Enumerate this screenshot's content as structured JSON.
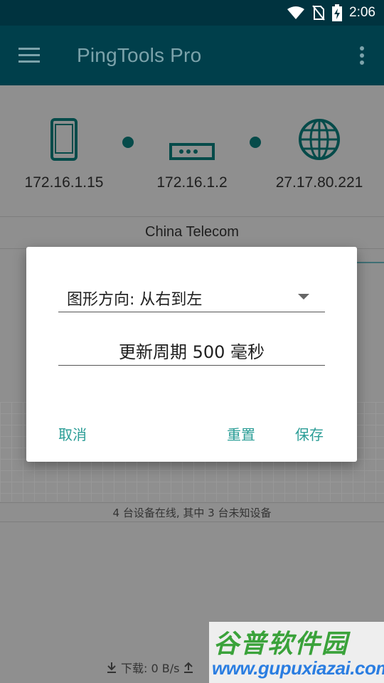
{
  "status_bar": {
    "time": "2:06"
  },
  "app_bar": {
    "title": "PingTools Pro"
  },
  "route": {
    "nodes": [
      {
        "ip": "172.16.1.15",
        "icon": "phone-icon"
      },
      {
        "ip": "172.16.1.2",
        "icon": "router-icon"
      },
      {
        "ip": "27.17.80.221",
        "icon": "globe-icon"
      }
    ],
    "isp": "China Telecom"
  },
  "network": {
    "devices_summary": "4 台设备在线, 其中 3 台未知设备",
    "download_label": "下载: 0 B/s"
  },
  "dialog": {
    "graph_direction": "图形方向: 从右到左",
    "update_period": "更新周期 500 毫秒",
    "cancel_label": "取消",
    "reset_label": "重置",
    "save_label": "保存"
  },
  "watermark": {
    "brand": "谷普软件园",
    "url": "www.gupuxiazai.com"
  },
  "colors": {
    "status_bar": "#00333f",
    "app_bar": "#003f4b",
    "accent": "#2a9d96",
    "icon_teal": "#064b4a",
    "scrim_background": "#8f8f8f"
  }
}
